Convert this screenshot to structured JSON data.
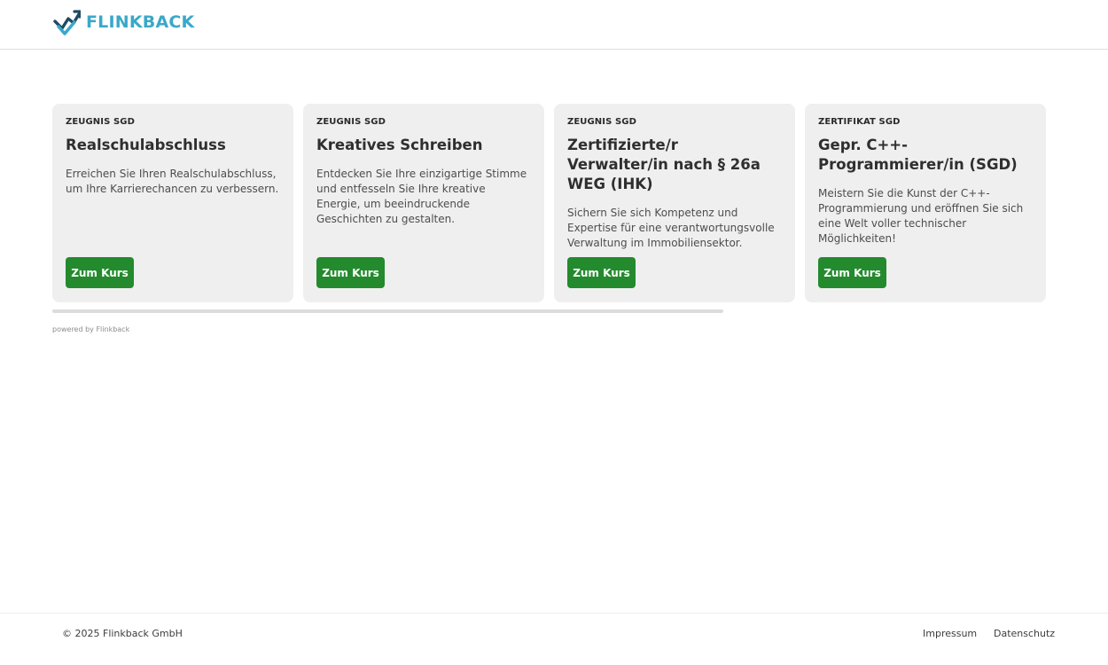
{
  "header": {
    "logo_text": "FLINKBACK",
    "logo_icon": "trend-check-icon",
    "brand_color": "#3aa8c9",
    "brand_dark": "#1f4a63"
  },
  "cards": [
    {
      "kicker": "ZEUGNIS SGD",
      "title": "Realschulabschluss",
      "description": "Erreichen Sie Ihren Realschulabschluss, um Ihre Karrierechancen zu verbessern.",
      "button_label": "Zum Kurs"
    },
    {
      "kicker": "ZEUGNIS SGD",
      "title": "Kreatives Schreiben",
      "description": "Entdecken Sie Ihre einzigartige Stimme und entfesseln Sie Ihre kreative Energie, um beeindruckende Geschichten zu gestalten.",
      "button_label": "Zum Kurs"
    },
    {
      "kicker": "ZEUGNIS SGD",
      "title": "Zertifizierte/r Verwalter/in nach § 26a WEG (IHK)",
      "description": "Sichern Sie sich Kompetenz und Expertise für eine verantwortungsvolle Verwaltung im Immobiliensektor.",
      "button_label": "Zum Kurs"
    },
    {
      "kicker": "ZERTIFIKAT SGD",
      "title": "Gepr. C++-Programmierer/in (SGD)",
      "description": "Meistern Sie die Kunst der C++-Programmierung und eröffnen Sie sich eine Welt voller technischer Möglichkeiten!",
      "button_label": "Zum Kurs"
    }
  ],
  "accent_color": "#238a2e",
  "powered_by": "powered by Flinkback",
  "footer": {
    "copyright": "© 2025 Flinkback GmbH",
    "links": [
      "Impressum",
      "Datenschutz"
    ]
  }
}
